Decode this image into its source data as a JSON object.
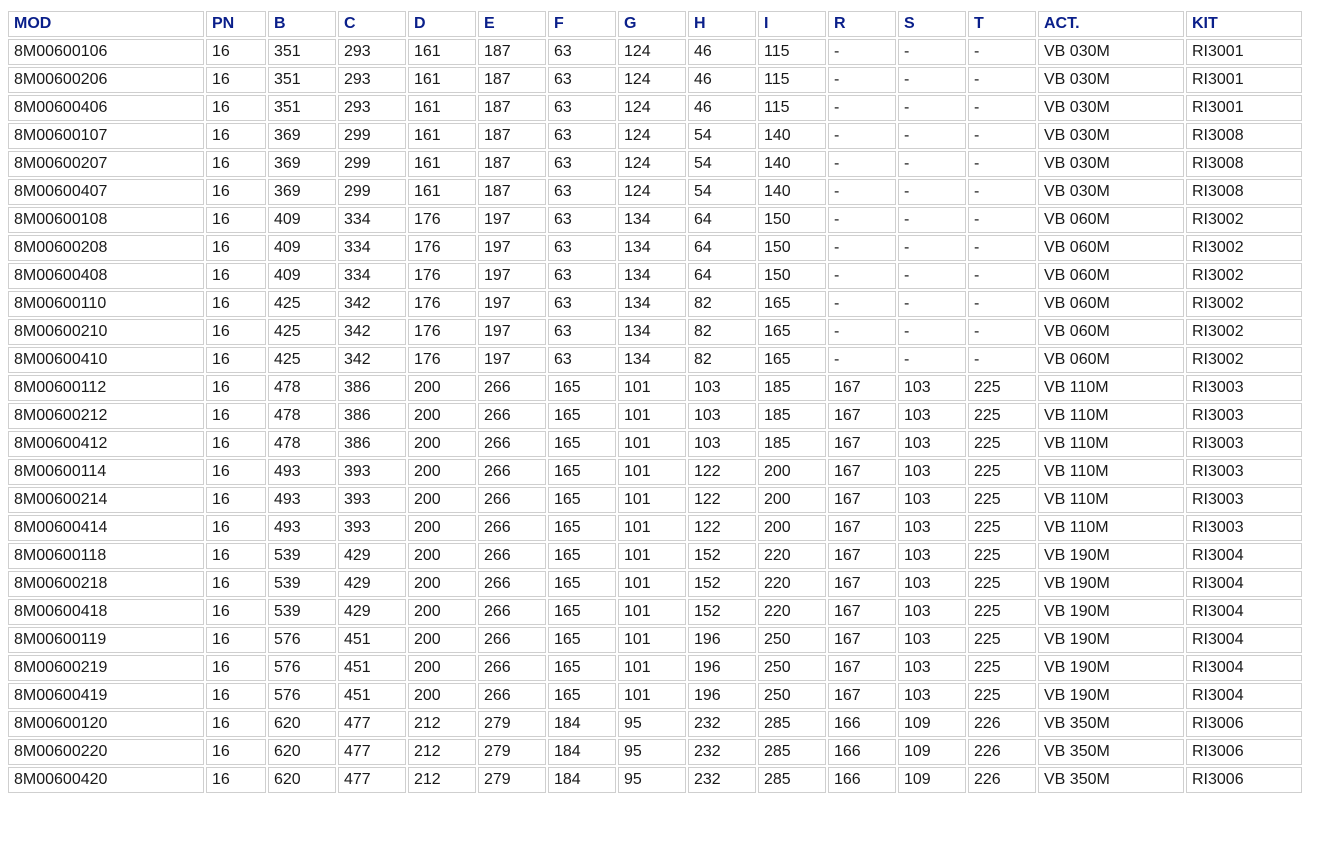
{
  "table": {
    "headers": [
      "MOD",
      "PN",
      "B",
      "C",
      "D",
      "E",
      "F",
      "G",
      "H",
      "I",
      "R",
      "S",
      "T",
      "ACT.",
      "KIT"
    ],
    "rows": [
      [
        "8M00600106",
        "16",
        "351",
        "293",
        "161",
        "187",
        "63",
        "124",
        "46",
        "115",
        "-",
        "-",
        "-",
        "VB 030M",
        "RI3001"
      ],
      [
        "8M00600206",
        "16",
        "351",
        "293",
        "161",
        "187",
        "63",
        "124",
        "46",
        "115",
        "-",
        "-",
        "-",
        "VB 030M",
        "RI3001"
      ],
      [
        "8M00600406",
        "16",
        "351",
        "293",
        "161",
        "187",
        "63",
        "124",
        "46",
        "115",
        "-",
        "-",
        "-",
        "VB 030M",
        "RI3001"
      ],
      [
        "8M00600107",
        "16",
        "369",
        "299",
        "161",
        "187",
        "63",
        "124",
        "54",
        "140",
        "-",
        "-",
        "-",
        "VB 030M",
        "RI3008"
      ],
      [
        "8M00600207",
        "16",
        "369",
        "299",
        "161",
        "187",
        "63",
        "124",
        "54",
        "140",
        "-",
        "-",
        "-",
        "VB 030M",
        "RI3008"
      ],
      [
        "8M00600407",
        "16",
        "369",
        "299",
        "161",
        "187",
        "63",
        "124",
        "54",
        "140",
        "-",
        "-",
        "-",
        "VB 030M",
        "RI3008"
      ],
      [
        "8M00600108",
        "16",
        "409",
        "334",
        "176",
        "197",
        "63",
        "134",
        "64",
        "150",
        "-",
        "-",
        "-",
        "VB 060M",
        "RI3002"
      ],
      [
        "8M00600208",
        "16",
        "409",
        "334",
        "176",
        "197",
        "63",
        "134",
        "64",
        "150",
        "-",
        "-",
        "-",
        "VB 060M",
        "RI3002"
      ],
      [
        "8M00600408",
        "16",
        "409",
        "334",
        "176",
        "197",
        "63",
        "134",
        "64",
        "150",
        "-",
        "-",
        "-",
        "VB 060M",
        "RI3002"
      ],
      [
        "8M00600110",
        "16",
        "425",
        "342",
        "176",
        "197",
        "63",
        "134",
        "82",
        "165",
        "-",
        "-",
        "-",
        "VB 060M",
        "RI3002"
      ],
      [
        "8M00600210",
        "16",
        "425",
        "342",
        "176",
        "197",
        "63",
        "134",
        "82",
        "165",
        "-",
        "-",
        "-",
        "VB 060M",
        "RI3002"
      ],
      [
        "8M00600410",
        "16",
        "425",
        "342",
        "176",
        "197",
        "63",
        "134",
        "82",
        "165",
        "-",
        "-",
        "-",
        "VB 060M",
        "RI3002"
      ],
      [
        "8M00600112",
        "16",
        "478",
        "386",
        "200",
        "266",
        "165",
        "101",
        "103",
        "185",
        "167",
        "103",
        "225",
        "VB 110M",
        "RI3003"
      ],
      [
        "8M00600212",
        "16",
        "478",
        "386",
        "200",
        "266",
        "165",
        "101",
        "103",
        "185",
        "167",
        "103",
        "225",
        "VB 110M",
        "RI3003"
      ],
      [
        "8M00600412",
        "16",
        "478",
        "386",
        "200",
        "266",
        "165",
        "101",
        "103",
        "185",
        "167",
        "103",
        "225",
        "VB 110M",
        "RI3003"
      ],
      [
        "8M00600114",
        "16",
        "493",
        "393",
        "200",
        "266",
        "165",
        "101",
        "122",
        "200",
        "167",
        "103",
        "225",
        "VB 110M",
        "RI3003"
      ],
      [
        "8M00600214",
        "16",
        "493",
        "393",
        "200",
        "266",
        "165",
        "101",
        "122",
        "200",
        "167",
        "103",
        "225",
        "VB 110M",
        "RI3003"
      ],
      [
        "8M00600414",
        "16",
        "493",
        "393",
        "200",
        "266",
        "165",
        "101",
        "122",
        "200",
        "167",
        "103",
        "225",
        "VB 110M",
        "RI3003"
      ],
      [
        "8M00600118",
        "16",
        "539",
        "429",
        "200",
        "266",
        "165",
        "101",
        "152",
        "220",
        "167",
        "103",
        "225",
        "VB 190M",
        "RI3004"
      ],
      [
        "8M00600218",
        "16",
        "539",
        "429",
        "200",
        "266",
        "165",
        "101",
        "152",
        "220",
        "167",
        "103",
        "225",
        "VB 190M",
        "RI3004"
      ],
      [
        "8M00600418",
        "16",
        "539",
        "429",
        "200",
        "266",
        "165",
        "101",
        "152",
        "220",
        "167",
        "103",
        "225",
        "VB 190M",
        "RI3004"
      ],
      [
        "8M00600119",
        "16",
        "576",
        "451",
        "200",
        "266",
        "165",
        "101",
        "196",
        "250",
        "167",
        "103",
        "225",
        "VB 190M",
        "RI3004"
      ],
      [
        "8M00600219",
        "16",
        "576",
        "451",
        "200",
        "266",
        "165",
        "101",
        "196",
        "250",
        "167",
        "103",
        "225",
        "VB 190M",
        "RI3004"
      ],
      [
        "8M00600419",
        "16",
        "576",
        "451",
        "200",
        "266",
        "165",
        "101",
        "196",
        "250",
        "167",
        "103",
        "225",
        "VB 190M",
        "RI3004"
      ],
      [
        "8M00600120",
        "16",
        "620",
        "477",
        "212",
        "279",
        "184",
        "95",
        "232",
        "285",
        "166",
        "109",
        "226",
        "VB 350M",
        "RI3006"
      ],
      [
        "8M00600220",
        "16",
        "620",
        "477",
        "212",
        "279",
        "184",
        "95",
        "232",
        "285",
        "166",
        "109",
        "226",
        "VB 350M",
        "RI3006"
      ],
      [
        "8M00600420",
        "16",
        "620",
        "477",
        "212",
        "279",
        "184",
        "95",
        "232",
        "285",
        "166",
        "109",
        "226",
        "VB 350M",
        "RI3006"
      ]
    ]
  },
  "colors": {
    "header_text": "#0a1f8a",
    "cell_text": "#1a1a1a",
    "border": "#cfcfcf"
  }
}
